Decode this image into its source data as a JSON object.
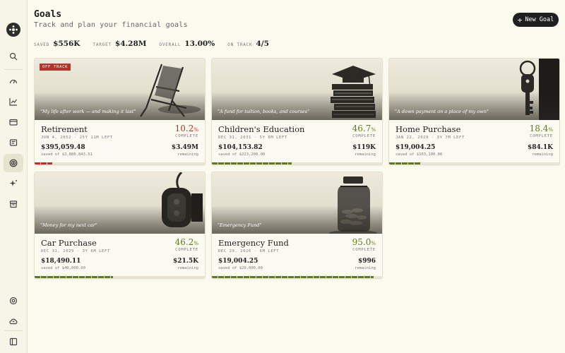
{
  "page": {
    "title": "Goals",
    "subtitle": "Track and plan your financial goals"
  },
  "actions": {
    "new_goal_label": "New Goal"
  },
  "stats": [
    {
      "label": "SAVED",
      "value": "$556K"
    },
    {
      "label": "TARGET",
      "value": "$4.28M"
    },
    {
      "label": "OVERALL",
      "value": "13.00%"
    },
    {
      "label": "ON TRACK",
      "value": "4/5"
    }
  ],
  "colors": {
    "off_track": "#b5332a",
    "on_track": "#5f7a1e",
    "ink": "#1f1f1f"
  },
  "sidebar": {
    "icons": [
      "compass-logo-icon",
      "search-icon",
      "gauge-icon",
      "line-chart-icon",
      "wallet-icon",
      "receipt-icon",
      "target-icon",
      "sparkle-icon",
      "archive-icon",
      "settings-icon",
      "cloud-sync-icon",
      "sidebar-toggle-icon"
    ],
    "active": "target-icon"
  },
  "goals": [
    {
      "name": "Retirement",
      "date": "JUN 4, 2052 · 25Y 11M LEFT",
      "percent": "10.2",
      "percent_value": 10.2,
      "complete_label": "COMPLETE",
      "saved": "$395,059.48",
      "saved_of": "saved of $3,880,843.51",
      "remaining": "$3.49M",
      "remaining_label": "remaining",
      "quote": "\"My life after work — and making it last\"",
      "badge": "OFF TRACK",
      "status": "off",
      "image": "beach-chair"
    },
    {
      "name": "Children's Education",
      "date": "DEC 31, 2031 · 5Y 6M LEFT",
      "percent": "46.7",
      "percent_value": 46.7,
      "complete_label": "COMPLETE",
      "saved": "$104,153.82",
      "saved_of": "saved of $223,200.00",
      "remaining": "$119K",
      "remaining_label": "remaining",
      "quote": "\"A fund for tuition, books, and courses\"",
      "badge": "",
      "status": "on",
      "image": "books-cap"
    },
    {
      "name": "Home Purchase",
      "date": "JAN 22, 2029 · 3Y 7M LEFT",
      "percent": "18.4",
      "percent_value": 18.4,
      "complete_label": "COMPLETE",
      "saved": "$19,004.25",
      "saved_of": "saved of $103,100.00",
      "remaining": "$84.1K",
      "remaining_label": "remaining",
      "quote": "\"A down payment on a place of my own\"",
      "badge": "",
      "status": "on",
      "image": "house-key"
    },
    {
      "name": "Car Purchase",
      "date": "DEC 31, 2029 · 3Y 6M LEFT",
      "percent": "46.2",
      "percent_value": 46.2,
      "complete_label": "COMPLETE",
      "saved": "$18,490.11",
      "saved_of": "saved of $40,000.00",
      "remaining": "$21.5K",
      "remaining_label": "remaining",
      "quote": "\"Money for my next car\"",
      "badge": "",
      "status": "on",
      "image": "car-key"
    },
    {
      "name": "Emergency Fund",
      "date": "DEC 29, 2026 · 6M LEFT",
      "percent": "95.0",
      "percent_value": 95.0,
      "complete_label": "COMPLETE",
      "saved": "$19,004.25",
      "saved_of": "saved of $20,000.00",
      "remaining": "$996",
      "remaining_label": "remaining",
      "quote": "\"Emergency Fund\"",
      "badge": "",
      "status": "on",
      "image": "coin-jar"
    }
  ]
}
